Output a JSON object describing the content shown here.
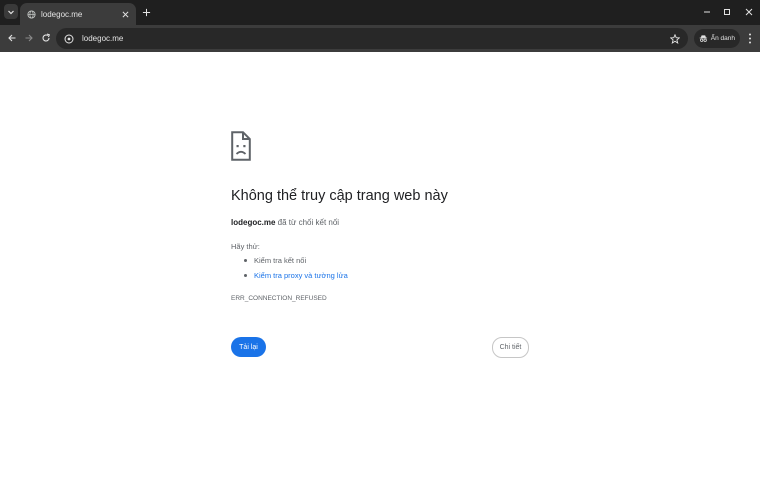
{
  "browser": {
    "tab": {
      "title": "lodegoc.me"
    },
    "address_bar": {
      "url": "lodegoc.me"
    },
    "incognito_label": "Ẩn danh",
    "icons": {
      "tab_search": "chevron-down-icon",
      "favicon": "globe-icon",
      "tab_close": "close-icon",
      "new_tab": "plus-icon",
      "minimize": "minimize-icon",
      "maximize": "maximize-icon",
      "close_window": "close-icon",
      "back": "back-arrow-icon",
      "forward": "forward-arrow-icon",
      "reload": "reload-icon",
      "site_info": "site-info-icon",
      "bookmark": "star-icon",
      "incognito": "incognito-icon",
      "menu": "kebab-menu-icon"
    }
  },
  "error_page": {
    "icon": "sad-document-icon",
    "heading": "Không thể truy cập trang web này",
    "host": "lodegoc.me",
    "message": " đã từ chối kết nối",
    "try_label": "Hãy thử:",
    "suggestions": [
      {
        "text": "Kiểm tra kết nối",
        "link": false
      },
      {
        "text": "Kiểm tra proxy và tường lửa",
        "link": true
      }
    ],
    "error_code": "ERR_CONNECTION_REFUSED",
    "reload_button": "Tải lại",
    "details_button": "Chi tiết"
  },
  "colors": {
    "tab_strip": "#1f1f1f",
    "toolbar": "#3c3c3c",
    "omnibox": "#282828",
    "accent_blue": "#1a73e8",
    "text_secondary": "#5f6368"
  }
}
